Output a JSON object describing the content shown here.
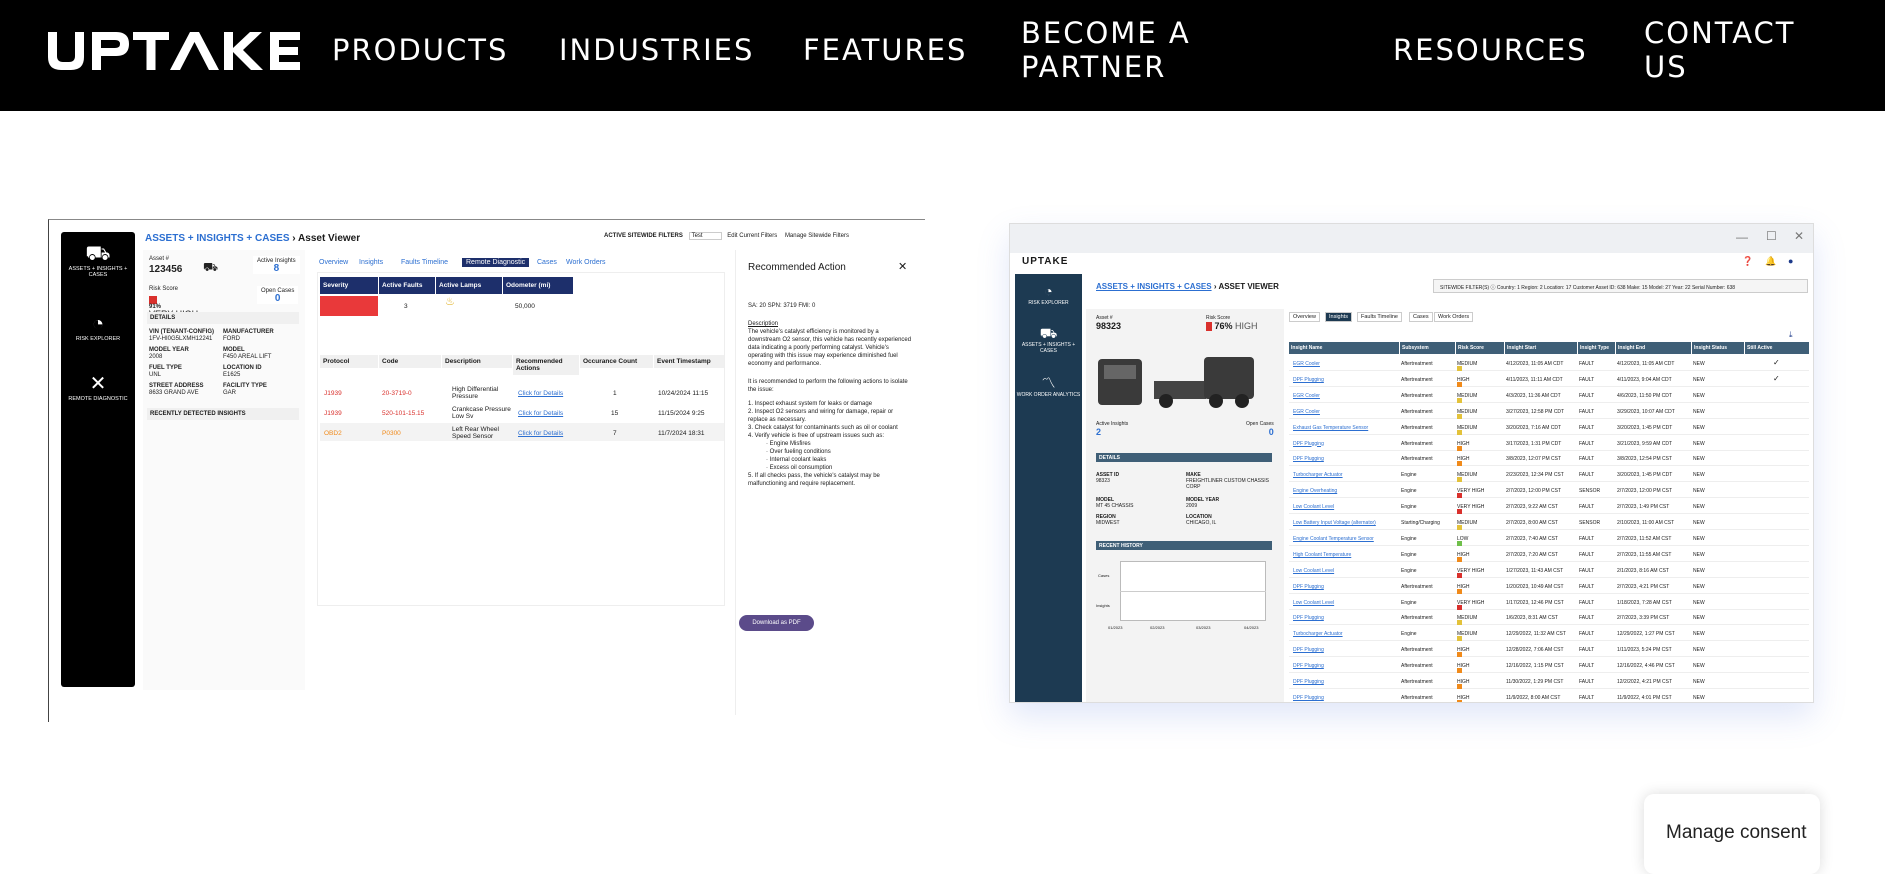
{
  "nav": {
    "logo_text": "UPTAKE",
    "links": [
      "PRODUCTS",
      "INDUSTRIES",
      "FEATURES",
      "BECOME A PARTNER",
      "RESOURCES",
      "CONTACT US"
    ]
  },
  "consent": {
    "label": "Manage consent"
  },
  "left_screenshot": {
    "sidebar": [
      {
        "label": "ASSETS + INSIGHTS + CASES",
        "icon": "truck-chart-icon"
      },
      {
        "label": "RISK EXPLORER",
        "icon": "gauge-icon"
      },
      {
        "label": "REMOTE DIAGNOSTIC",
        "icon": "tools-icon"
      }
    ],
    "breadcrumb": {
      "link": "ASSETS + INSIGHTS + CASES",
      "sep": "›",
      "current": "Asset Viewer"
    },
    "filters": {
      "label": "ACTIVE SITEWIDE FILTERS",
      "value": "Test",
      "edit": "Edit Current Filters",
      "manage": "Manage Sitewide Filters"
    },
    "asset": {
      "asset_label": "Asset #",
      "asset_value": "123456",
      "insights_label": "Active Insights",
      "insights_value": "8",
      "risk_label": "Risk Score",
      "risk_value": "91%",
      "risk_level": "VERY HIGH",
      "cases_label": "Open Cases",
      "cases_value": "0",
      "details_title": "DETAILS",
      "fields": [
        {
          "k": "VIN (TENANT-CONFIG)",
          "v": "1FV-HI0G5LXMH12241"
        },
        {
          "k": "MANUFACTURER",
          "v": "FORD"
        },
        {
          "k": "MODEL YEAR",
          "v": "2008"
        },
        {
          "k": "MODEL",
          "v": "F450 AREAL LIFT"
        },
        {
          "k": "FUEL TYPE",
          "v": "UNL"
        },
        {
          "k": "LOCATION ID",
          "v": "E1625"
        },
        {
          "k": "STREET ADDRESS",
          "v": "8633 GRAND AVE"
        },
        {
          "k": "FACILITY TYPE",
          "v": "GAR"
        }
      ],
      "recent_title": "RECENTLY DETECTED INSIGHTS"
    },
    "tabs": [
      "Overview",
      "Insights",
      "Faults Timeline",
      "Remote Diagnostic",
      "Cases",
      "Work Orders"
    ],
    "summary_headers": [
      "Severity",
      "Active Faults",
      "Active Lamps",
      "Odometer (mi)"
    ],
    "summary_values": {
      "faults": "3",
      "odometer": "50,000"
    },
    "fault_headers": [
      "Protocol",
      "Code",
      "Description",
      "Recommended Actions",
      "Occurance Count",
      "Event Timestamp"
    ],
    "faults": [
      {
        "protocol": "J1939",
        "code": "20-3719-0",
        "desc": "High Differential Pressure",
        "action": "Click for Details",
        "count": "1",
        "time": "10/24/2024 11:15"
      },
      {
        "protocol": "J1939",
        "code": "520-101-15.15",
        "desc": "Crankcase Pressure Low Sv",
        "action": "Click for Details",
        "count": "15",
        "time": "11/15/2024 9:25"
      },
      {
        "protocol": "OBD2",
        "code": "P0300",
        "desc": "Left Rear Wheel Speed Sensor",
        "action": "Click for Details",
        "count": "7",
        "time": "11/7/2024 18:31"
      }
    ],
    "recommended": {
      "title": "Recommended Action",
      "code_line": "SA: 20 SPN: 3719 FMI: 0",
      "desc_title": "Description",
      "desc": "The vehicle's catalyst efficiency is monitored by a downstream O2 sensor, this vehicle has recently experienced data indicating a poorly performing catalyst. Vehicle's operating with this issue may experience diminished fuel economy and performance.",
      "intro": "It is recommended to perform the following actions to isolate the issue:",
      "steps": [
        "1. Inspect exhaust system for leaks or damage",
        "2. Inspect O2 sensors and wiring for damage, repair or replace as necessary.",
        "3. Check catalyst for contaminants such as oil or coolant",
        "4. Verify vehicle is free of upstream issues such as:",
        "· Engine Misfires",
        "· Over fueling conditions",
        "· Internal coolant leaks",
        "· Excess oil consumption",
        "5. If all checks pass, the vehicle's catalyst may be malfunctioning and require replacement."
      ],
      "pdf_button": "Download as PDF"
    }
  },
  "right_screenshot": {
    "app_logo": "UPTAKE",
    "sidebar": [
      {
        "label": "RISK EXPLORER",
        "icon": "gauge-icon"
      },
      {
        "label": "ASSETS + INSIGHTS + CASES",
        "icon": "truck-chart-icon"
      },
      {
        "label": "WORK ORDER ANALYTICS",
        "icon": "chart-line-icon"
      }
    ],
    "breadcrumb": {
      "link": "ASSETS + INSIGHTS + CASES",
      "sep": "›",
      "current": "ASSET VIEWER"
    },
    "filters": "SITEWIDE FILTER(S) ⓘ   Country: 1   Region: 2   Location: 17   Customer Asset ID: 638   Make: 15   Model: 27   Year: 22   Serial Number: 638",
    "asset": {
      "asset_label": "Asset #",
      "asset_value": "98323",
      "risk_label": "Risk Score",
      "risk_value": "76%",
      "risk_level": "HIGH",
      "insights_label": "Active Insights",
      "insights_value": "2",
      "cases_label": "Open Cases",
      "cases_value": "0",
      "details_title": "DETAILS",
      "fields": [
        {
          "k": "ASSET ID",
          "v": "98323"
        },
        {
          "k": "MAKE",
          "v": "FREIGHTLINER CUSTOM CHASSIS CORP"
        },
        {
          "k": "MODEL",
          "v": "MT 45 CHASSIS"
        },
        {
          "k": "MODEL YEAR",
          "v": "2009"
        },
        {
          "k": "REGION",
          "v": "MIDWEST"
        },
        {
          "k": "LOCATION",
          "v": "CHICAGO, IL"
        }
      ],
      "history_title": "RECENT HISTORY",
      "history_rows": [
        "Cases",
        "Insights"
      ],
      "history_dates": [
        "01/2023",
        "02/2023",
        "03/2023",
        "04/2023"
      ]
    },
    "tabs": [
      "Overview",
      "Insights",
      "Faults Timeline",
      "Cases",
      "Work Orders"
    ],
    "headers": [
      "Insight Name",
      "Subsystem",
      "Risk Score",
      "Insight Start",
      "Insight Type",
      "Insight End",
      "Insight Status",
      "Still Active"
    ],
    "rows": [
      {
        "name": "EGR Cooler",
        "sub": "Aftertreatment",
        "risk": "MEDIUM",
        "start": "4/12/2023, 11:05 AM CDT",
        "type": "FAULT",
        "end": "4/12/2023, 11:05 AM CDT",
        "status": "NEW",
        "active": "✓"
      },
      {
        "name": "DPF Plugging",
        "sub": "Aftertreatment",
        "risk": "HIGH",
        "start": "4/11/2023, 11:11 AM CDT",
        "type": "FAULT",
        "end": "4/11/2023, 9:04 AM CDT",
        "status": "NEW",
        "active": "✓"
      },
      {
        "name": "EGR Cooler",
        "sub": "Aftertreatment",
        "risk": "MEDIUM",
        "start": "4/3/2023, 11:36 AM CDT",
        "type": "FAULT",
        "end": "4/6/2023, 11:50 PM CDT",
        "status": "NEW",
        "active": ""
      },
      {
        "name": "EGR Cooler",
        "sub": "Aftertreatment",
        "risk": "MEDIUM",
        "start": "3/27/2023, 12:58 PM CDT",
        "type": "FAULT",
        "end": "3/29/2023, 10:07 AM CDT",
        "status": "NEW",
        "active": ""
      },
      {
        "name": "Exhaust Gas Temperature Sensor",
        "sub": "Aftertreatment",
        "risk": "MEDIUM",
        "start": "3/20/2023, 7:16 AM CDT",
        "type": "FAULT",
        "end": "3/20/2023, 1:45 PM CDT",
        "status": "NEW",
        "active": ""
      },
      {
        "name": "DPF Plugging",
        "sub": "Aftertreatment",
        "risk": "HIGH",
        "start": "3/17/2023, 1:31 PM CDT",
        "type": "FAULT",
        "end": "3/21/2023, 9:59 AM CDT",
        "status": "NEW",
        "active": ""
      },
      {
        "name": "DPF Plugging",
        "sub": "Aftertreatment",
        "risk": "HIGH",
        "start": "3/8/2023, 12:07 PM CST",
        "type": "FAULT",
        "end": "3/8/2023, 12:54 PM CST",
        "status": "NEW",
        "active": ""
      },
      {
        "name": "Turbocharger Actuator",
        "sub": "Engine",
        "risk": "MEDIUM",
        "start": "2/23/2023, 12:34 PM CST",
        "type": "FAULT",
        "end": "3/20/2023, 1:45 PM CDT",
        "status": "NEW",
        "active": ""
      },
      {
        "name": "Engine Overheating",
        "sub": "Engine",
        "risk": "VERY HIGH",
        "start": "2/7/2023, 12:00 PM CST",
        "type": "SENSOR",
        "end": "2/7/2023, 12:00 PM CST",
        "status": "NEW",
        "active": ""
      },
      {
        "name": "Low Coolant Level",
        "sub": "Engine",
        "risk": "VERY HIGH",
        "start": "2/7/2023, 9:22 AM CST",
        "type": "FAULT",
        "end": "2/7/2023, 1:49 PM CST",
        "status": "NEW",
        "active": ""
      },
      {
        "name": "Low Battery Input Voltage (alternator)",
        "sub": "Starting/Charging",
        "risk": "MEDIUM",
        "start": "2/7/2023, 8:00 AM CST",
        "type": "SENSOR",
        "end": "2/10/2023, 11:00 AM CST",
        "status": "NEW",
        "active": ""
      },
      {
        "name": "Engine Coolant Temperature Sensor",
        "sub": "Engine",
        "risk": "LOW",
        "start": "2/7/2023, 7:40 AM CST",
        "type": "FAULT",
        "end": "2/7/2023, 11:52 AM CST",
        "status": "NEW",
        "active": ""
      },
      {
        "name": "High Coolant Temperature",
        "sub": "Engine",
        "risk": "HIGH",
        "start": "2/7/2023, 7:20 AM CST",
        "type": "FAULT",
        "end": "2/7/2023, 11:55 AM CST",
        "status": "NEW",
        "active": ""
      },
      {
        "name": "Low Coolant Level",
        "sub": "Engine",
        "risk": "VERY HIGH",
        "start": "1/27/2023, 11:43 AM CST",
        "type": "FAULT",
        "end": "2/1/2023, 8:16 AM CST",
        "status": "NEW",
        "active": ""
      },
      {
        "name": "DPF Plugging",
        "sub": "Aftertreatment",
        "risk": "HIGH",
        "start": "1/20/2023, 10:49 AM CST",
        "type": "FAULT",
        "end": "2/7/2023, 4:21 PM CST",
        "status": "NEW",
        "active": ""
      },
      {
        "name": "Low Coolant Level",
        "sub": "Engine",
        "risk": "VERY HIGH",
        "start": "1/17/2023, 12:46 PM CST",
        "type": "FAULT",
        "end": "1/18/2023, 7:28 AM CST",
        "status": "NEW",
        "active": ""
      },
      {
        "name": "DPF Plugging",
        "sub": "Aftertreatment",
        "risk": "MEDIUM",
        "start": "1/6/2023, 8:31 AM CST",
        "type": "FAULT",
        "end": "2/7/2023, 3:39 PM CST",
        "status": "NEW",
        "active": ""
      },
      {
        "name": "Turbocharger Actuator",
        "sub": "Engine",
        "risk": "MEDIUM",
        "start": "12/29/2022, 11:32 AM CST",
        "type": "FAULT",
        "end": "12/29/2022, 1:27 PM CST",
        "status": "NEW",
        "active": ""
      },
      {
        "name": "DPF Plugging",
        "sub": "Aftertreatment",
        "risk": "HIGH",
        "start": "12/28/2022, 7:06 AM CST",
        "type": "FAULT",
        "end": "1/11/2023, 5:24 PM CST",
        "status": "NEW",
        "active": ""
      },
      {
        "name": "DPF Plugging",
        "sub": "Aftertreatment",
        "risk": "HIGH",
        "start": "12/16/2022, 1:15 PM CST",
        "type": "FAULT",
        "end": "12/16/2022, 4:46 PM CST",
        "status": "NEW",
        "active": ""
      },
      {
        "name": "DPF Plugging",
        "sub": "Aftertreatment",
        "risk": "HIGH",
        "start": "11/30/2022, 1:29 PM CST",
        "type": "FAULT",
        "end": "12/2/2022, 4:21 PM CST",
        "status": "NEW",
        "active": ""
      },
      {
        "name": "DPF Plugging",
        "sub": "Aftertreatment",
        "risk": "HIGH",
        "start": "11/9/2022, 8:00 AM CST",
        "type": "FAULT",
        "end": "11/9/2022, 4:01 PM CST",
        "status": "NEW",
        "active": ""
      }
    ],
    "risk_colors": {
      "LOW": "#6fbf4a",
      "MEDIUM": "#e3c23a",
      "HIGH": "#f08a1a",
      "VERY HIGH": "#d9302c"
    }
  }
}
